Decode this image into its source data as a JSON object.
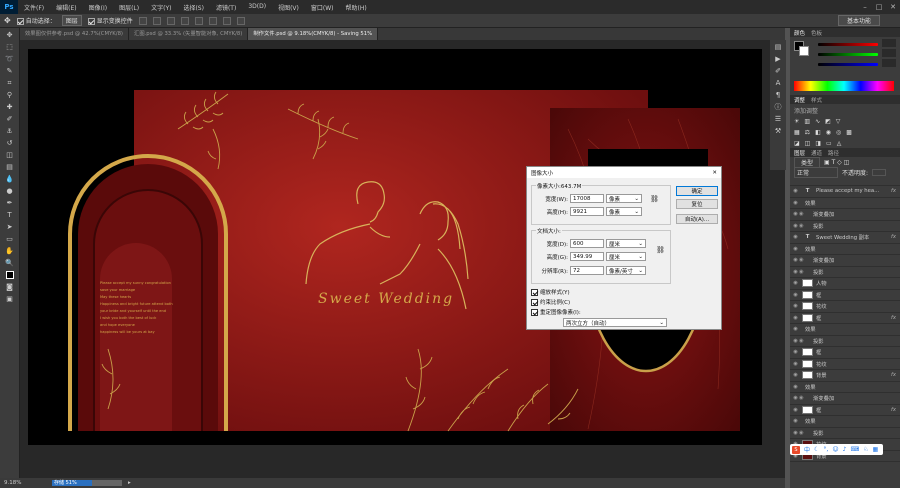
{
  "app": {
    "logo": "Ps",
    "menu": [
      "文件(F)",
      "编辑(E)",
      "图像(I)",
      "图层(L)",
      "文字(Y)",
      "选择(S)",
      "滤镜(T)",
      "3D(D)",
      "视图(V)",
      "窗口(W)",
      "帮助(H)"
    ],
    "workspace": "基本功能"
  },
  "options": {
    "auto_select": "自动选择：",
    "auto_select_value": "图层",
    "show_transform": "显示变换控件"
  },
  "tabs": [
    "效果图仅供参考.psd @ 42.7%(CMYK/8)",
    "汇图.psd @ 33.3% (矢量智能对象, CMYK/8)",
    "制作文件.psd @ 9.18%(CMYK/8) - Saving 51%"
  ],
  "status": {
    "zoom": "9.18%",
    "saving": "存储 51%"
  },
  "artwork": {
    "title": "Sweet Wedding",
    "verse": [
      "Please accept my sunny congratulation",
      "save your marriage",
      "May these hearts",
      "Happiness and bright future attend both",
      "your bride and yourself until the end",
      "I wish you both the best of luck",
      "and hope everyone",
      "happiness will be yours at bay"
    ]
  },
  "dialog": {
    "title": "图像大小",
    "pixel_size": "像素大小:643.7M",
    "width_label": "宽度(W):",
    "width_value": "17008",
    "width_unit": "像素",
    "height_label": "高度(H):",
    "height_value": "9921",
    "height_unit": "像素",
    "doc_size": "文档大小:",
    "dwidth_label": "宽度(D):",
    "dwidth_value": "600",
    "dwidth_unit": "厘米",
    "dheight_label": "高度(G):",
    "dheight_value": "349.99",
    "dheight_unit": "厘米",
    "res_label": "分辨率(R):",
    "res_value": "72",
    "res_unit": "像素/英寸",
    "scale_styles": "缩放样式(Y)",
    "constrain": "约束比例(C)",
    "resample": "重定图像像素(I):",
    "method": "两次立方（自动）",
    "ok": "确定",
    "reset": "复位",
    "auto": "自动(A)..."
  },
  "panels": {
    "color_tab": "颜色",
    "swatch_tab": "色板",
    "adjust_tab": "调整",
    "style_tab": "样式",
    "add_adjust": "添加调整",
    "layer_tabs": [
      "图层",
      "通道",
      "路径"
    ],
    "blend": "正常",
    "opacity": "不透明度:",
    "layers": [
      {
        "name": "Please accept my hea...",
        "type": "text",
        "fx": true
      },
      {
        "name": "效果",
        "type": "sub"
      },
      {
        "name": "渐变叠加",
        "type": "sub2"
      },
      {
        "name": "投影",
        "type": "sub2"
      },
      {
        "name": "Sweet Wedding 副本",
        "type": "text",
        "fx": true
      },
      {
        "name": "效果",
        "type": "sub"
      },
      {
        "name": "渐变叠加",
        "type": "sub2"
      },
      {
        "name": "投影",
        "type": "sub2"
      },
      {
        "name": "人物",
        "type": "img"
      },
      {
        "name": "框",
        "type": "img"
      },
      {
        "name": "花纹",
        "type": "img"
      },
      {
        "name": "框",
        "type": "img",
        "fx": true
      },
      {
        "name": "效果",
        "type": "sub"
      },
      {
        "name": "投影",
        "type": "sub2"
      },
      {
        "name": "框",
        "type": "img"
      },
      {
        "name": "花纹",
        "type": "img"
      },
      {
        "name": "背景",
        "type": "img",
        "fx": true
      },
      {
        "name": "效果",
        "type": "sub"
      },
      {
        "name": "渐变叠加",
        "type": "sub2"
      },
      {
        "name": "框",
        "type": "img",
        "fx": true
      },
      {
        "name": "效果",
        "type": "sub"
      },
      {
        "name": "投影",
        "type": "sub2"
      },
      {
        "name": "花纹",
        "type": "img"
      },
      {
        "name": "背景",
        "type": "img"
      }
    ]
  },
  "ime": {
    "label": "中"
  },
  "colors": {
    "accent_red": "#8b1414",
    "gold": "#d4a84a",
    "panel_bg": "#3c3c3c"
  }
}
